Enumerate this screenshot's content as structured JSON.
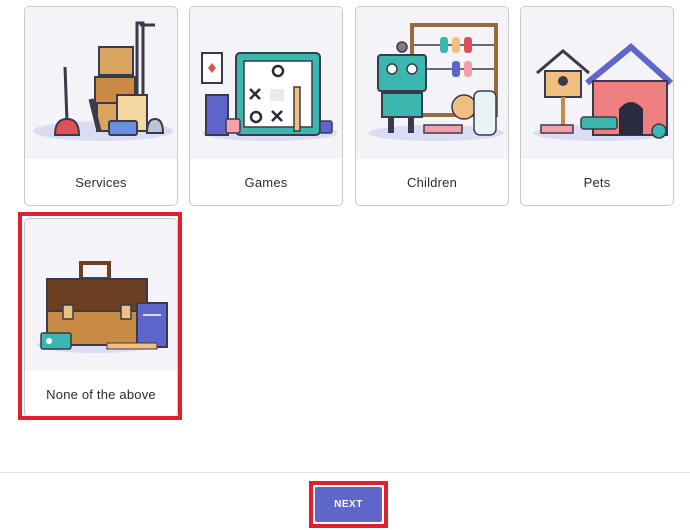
{
  "options": [
    {
      "label": "Services",
      "icon": "services-illustration-icon"
    },
    {
      "label": "Games",
      "icon": "games-illustration-icon"
    },
    {
      "label": "Children",
      "icon": "children-illustration-icon"
    },
    {
      "label": "Pets",
      "icon": "pets-illustration-icon"
    },
    {
      "label": "None of the above",
      "icon": "briefcase-illustration-icon",
      "selected": true
    }
  ],
  "footer": {
    "next_label": "NEXT"
  },
  "colors": {
    "accent": "#5f66c9",
    "highlight": "#e0202e",
    "card_bg": "#f3f3f8"
  }
}
